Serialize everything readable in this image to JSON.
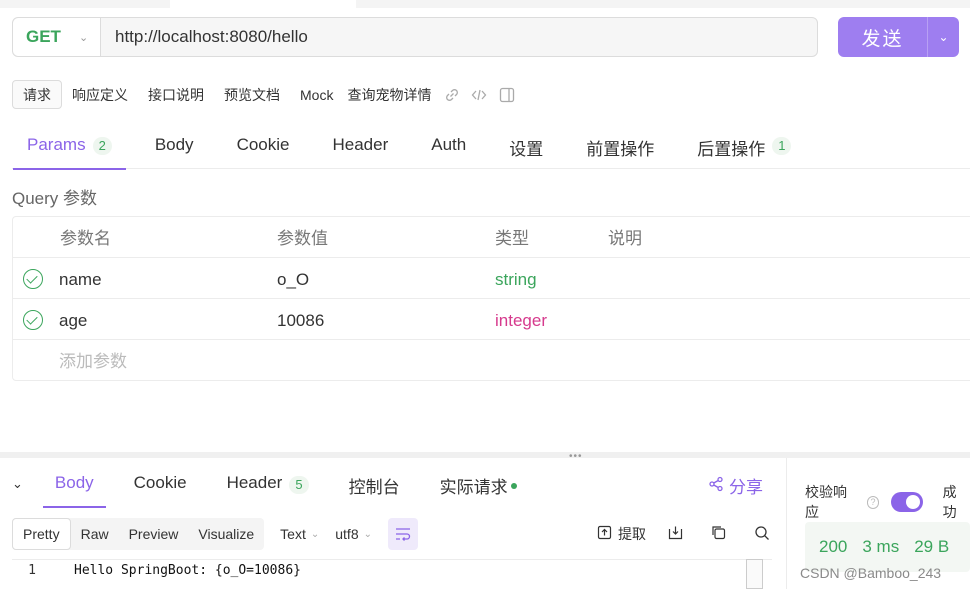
{
  "request": {
    "method": "GET",
    "url": "http://localhost:8080/hello",
    "send_label": "发送"
  },
  "subtabs": [
    {
      "label": "请求",
      "active": true
    },
    {
      "label": "响应定义"
    },
    {
      "label": "接口说明"
    },
    {
      "label": "预览文档"
    },
    {
      "label": "Mock"
    },
    {
      "label": "查询宠物详情"
    }
  ],
  "tabs": {
    "params": {
      "label": "Params",
      "badge": "2"
    },
    "body": "Body",
    "cookie": "Cookie",
    "header": "Header",
    "auth": "Auth",
    "settings": "设置",
    "pre": "前置操作",
    "post": {
      "label": "后置操作",
      "badge": "1"
    }
  },
  "query": {
    "title": "Query 参数",
    "headers": [
      "参数名",
      "参数值",
      "类型",
      "说明"
    ],
    "rows": [
      {
        "name": "name",
        "value": "o_O",
        "type": "string"
      },
      {
        "name": "age",
        "value": "10086",
        "type": "integer"
      }
    ],
    "add_label": "添加参数"
  },
  "response": {
    "tabs": {
      "body": "Body",
      "cookie": "Cookie",
      "header": {
        "label": "Header",
        "badge": "5"
      },
      "console": "控制台",
      "actual": "实际请求"
    },
    "share_label": "分享",
    "formats": [
      "Pretty",
      "Raw",
      "Preview",
      "Visualize"
    ],
    "type_select": "Text",
    "encoding_select": "utf8",
    "extract_label": "提取",
    "code_line_no": "1",
    "code_text": "Hello SpringBoot: {o_O=10086}"
  },
  "verify": {
    "label": "校验响应",
    "extra": "成功"
  },
  "stats": {
    "status": "200",
    "time": "3 ms",
    "size": "29 B"
  },
  "watermark": "CSDN @Bamboo_243",
  "colors": {
    "accent": "#8b64e8",
    "success": "#3ba55c",
    "integer": "#d63a8d"
  }
}
